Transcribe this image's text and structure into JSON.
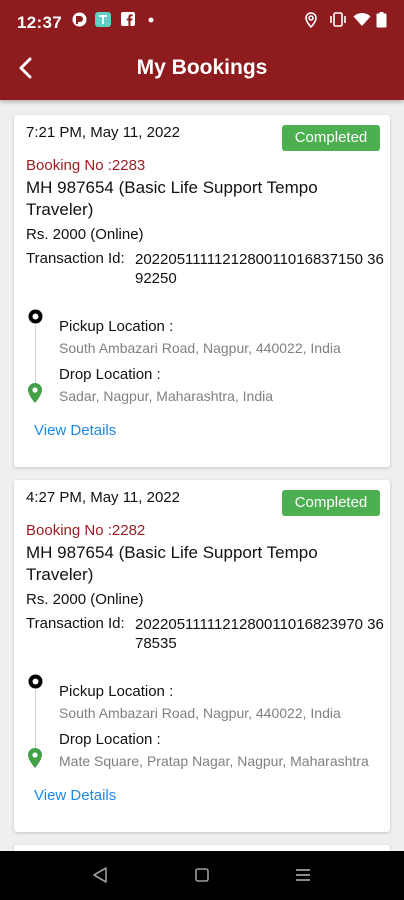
{
  "status_bar": {
    "time": "12:37"
  },
  "header": {
    "title": "My Bookings"
  },
  "bookings": [
    {
      "datetime": "7:21 PM, May 11, 2022",
      "status": "Completed",
      "booking_no": "Booking No :2283",
      "vehicle": "MH 987654 (Basic Life Support Tempo Traveler)",
      "amount": "Rs. 2000 (Online)",
      "transaction_label": "Transaction Id:",
      "transaction_id": "2022051111121280011016837150 3692250",
      "pickup_label": "Pickup Location :",
      "pickup": "South Ambazari Road, Nagpur, 440022, India",
      "drop_label": "Drop Location :",
      "drop": "Sadar, Nagpur, Maharashtra, India",
      "view_details": "View Details"
    },
    {
      "datetime": "4:27 PM, May 11, 2022",
      "status": "Completed",
      "booking_no": "Booking No :2282",
      "vehicle": "MH 987654 (Basic Life Support Tempo Traveler)",
      "amount": "Rs. 2000 (Online)",
      "transaction_label": "Transaction Id:",
      "transaction_id": "2022051111121280011016823970 3678535",
      "pickup_label": "Pickup Location :",
      "pickup": "South Ambazari Road, Nagpur, 440022, India",
      "drop_label": "Drop Location :",
      "drop": "Mate Square, Pratap Nagar, Nagpur, Maharashtra",
      "view_details": "View Details"
    }
  ],
  "colors": {
    "app_bar": "#8e1b1e",
    "status_completed": "#4caf50",
    "booking_no": "#9a1c1f",
    "link": "#1e88e5",
    "drop_pin": "#43a047"
  },
  "icons": [
    "back-arrow-icon",
    "location-icon",
    "vibrate-icon",
    "wifi-icon",
    "battery-icon"
  ]
}
